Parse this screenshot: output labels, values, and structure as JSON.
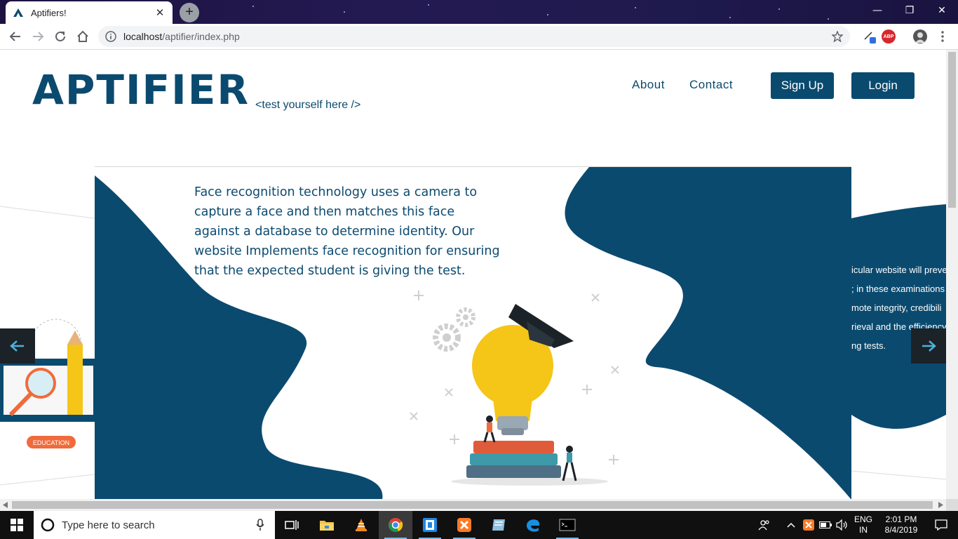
{
  "browser": {
    "tab_title": "Aptifiers!",
    "tab_close": "✕",
    "new_tab": "+",
    "url_host": "localhost",
    "url_path": "/aptifier/index.php",
    "abp_label": "ABP"
  },
  "window_controls": {
    "minimize": "—",
    "restore": "❐",
    "close": "✕"
  },
  "site": {
    "logo": "APTIFIER",
    "tagline": "<test yourself here />",
    "nav": {
      "about": "About",
      "contact": "Contact"
    },
    "buttons": {
      "signup": "Sign Up",
      "login": "Login"
    }
  },
  "slider": {
    "main_text": "Face recognition technology uses a camera to capture a face and then matches this face against a database to determine identity. Our website Implements face recognition for ensuring that the expected student is giving the test.",
    "next_slide_lines": [
      "icular website will preve",
      "; in these examinations",
      "mote integrity, credibili",
      "rieval and the efficiency",
      "ng tests."
    ],
    "left_badge": "EDUCATION"
  },
  "taskbar": {
    "search_placeholder": "Type here to search",
    "lang_top": "ENG",
    "lang_bottom": "IN",
    "time": "2:01 PM",
    "date": "8/4/2019"
  },
  "colors": {
    "brand": "#0b4a6f",
    "bulb": "#f5c518"
  }
}
